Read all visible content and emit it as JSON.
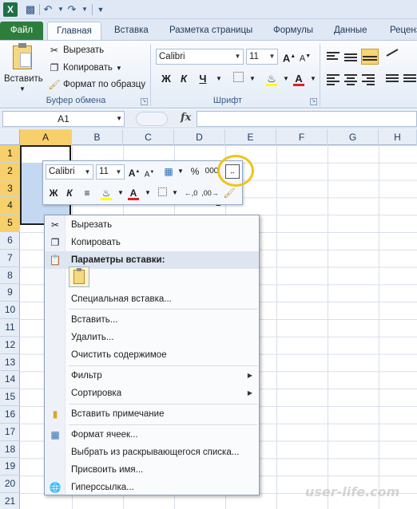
{
  "quick_access": {
    "app_icon": "X",
    "save_icon": "save-icon",
    "undo_icon": "undo-icon",
    "redo_icon": "redo-icon"
  },
  "tabs": [
    {
      "label": "Файл"
    },
    {
      "label": "Главная"
    },
    {
      "label": "Вставка"
    },
    {
      "label": "Разметка страницы"
    },
    {
      "label": "Формулы"
    },
    {
      "label": "Данные"
    },
    {
      "label": "Реценз"
    }
  ],
  "ribbon": {
    "clipboard": {
      "paste_label": "Вставить",
      "cut_label": "Вырезать",
      "copy_label": "Копировать",
      "format_painter_label": "Формат по образцу",
      "group_label": "Буфер обмена"
    },
    "font": {
      "font_name": "Calibri",
      "font_size": "11",
      "bold": "Ж",
      "italic": "К",
      "underline": "Ч",
      "grow": "A",
      "shrink": "A",
      "font_color_glyph": "A",
      "group_label": "Шрифт"
    }
  },
  "formula_bar": {
    "name_box": "A1",
    "fx": "fx",
    "value": ""
  },
  "grid": {
    "columns": [
      "A",
      "B",
      "C",
      "D",
      "E",
      "F",
      "G",
      "H"
    ],
    "rows": [
      "1",
      "2",
      "3",
      "4",
      "5",
      "6",
      "7",
      "8",
      "9",
      "10",
      "11",
      "12",
      "13",
      "14",
      "15",
      "16",
      "17",
      "18",
      "19",
      "20",
      "21",
      "22"
    ],
    "selected_column": "A",
    "selected_rows": [
      "1",
      "2",
      "3",
      "4",
      "5"
    ],
    "visible_value": "2"
  },
  "mini_toolbar": {
    "font_name": "Calibri",
    "font_size": "11",
    "percent": "%",
    "thousands": "000",
    "bold": "Ж",
    "italic": "К",
    "font_color_glyph": "A",
    "inc_decimal": ",0",
    "dec_decimal": ",00"
  },
  "context_menu": {
    "cut": "Вырезать",
    "copy": "Копировать",
    "paste_options_header": "Параметры вставки:",
    "paste_special": "Специальная вставка...",
    "insert": "Вставить...",
    "delete": "Удалить...",
    "clear_contents": "Очистить содержимое",
    "filter": "Фильтр",
    "sort": "Сортировка",
    "insert_comment": "Вставить примечание",
    "format_cells": "Формат ячеек...",
    "pick_from_list": "Выбрать из раскрывающегося списка...",
    "define_name": "Присвоить имя...",
    "hyperlink": "Гиперссылка..."
  },
  "watermark": "user-life.com",
  "colors": {
    "selection_header": "#f7d06b",
    "file_tab": "#2d7d3d",
    "highlight_ring": "#f1c418",
    "selection_fill": "#c5d8f1"
  }
}
